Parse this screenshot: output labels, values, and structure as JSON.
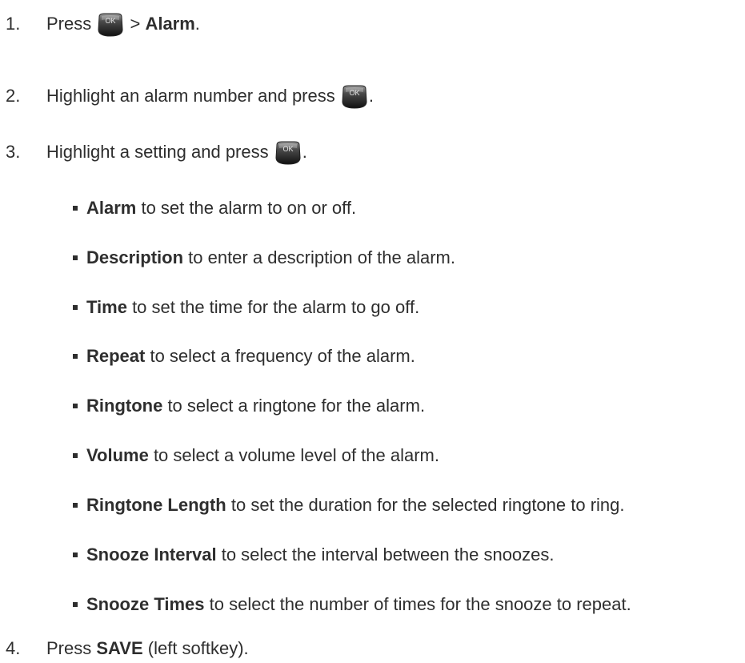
{
  "steps": [
    {
      "num": "1.",
      "pre": "Press ",
      "post_sep": " > ",
      "bold": "Alarm",
      "end": "."
    },
    {
      "num": "2.",
      "pre": "Highlight an alarm number and press ",
      "end": "."
    },
    {
      "num": "3.",
      "pre": "Highlight a setting and press ",
      "end": "."
    },
    {
      "num": "4.",
      "pre": "Press ",
      "bold": "SAVE",
      "end": " (left softkey)."
    }
  ],
  "ok_key_label": "OK",
  "ok_key_icon": "ok-key-icon",
  "settings": [
    {
      "term": "Alarm",
      "desc": " to set the alarm to on or off."
    },
    {
      "term": "Description",
      "desc": " to enter a description of the alarm."
    },
    {
      "term": "Time",
      "desc": " to set the time for the alarm to go off."
    },
    {
      "term": "Repeat",
      "desc": " to select a frequency of the alarm."
    },
    {
      "term": "Ringtone",
      "desc": " to select a ringtone for the alarm."
    },
    {
      "term": "Volume",
      "desc": " to select a volume level of the alarm."
    },
    {
      "term": "Ringtone Length",
      "desc": " to set the duration for the selected ringtone to ring."
    },
    {
      "term": "Snooze Interval",
      "desc": " to select the interval between the snoozes."
    },
    {
      "term": "Snooze Times",
      "desc": " to select the number of times for the snooze to repeat."
    }
  ]
}
